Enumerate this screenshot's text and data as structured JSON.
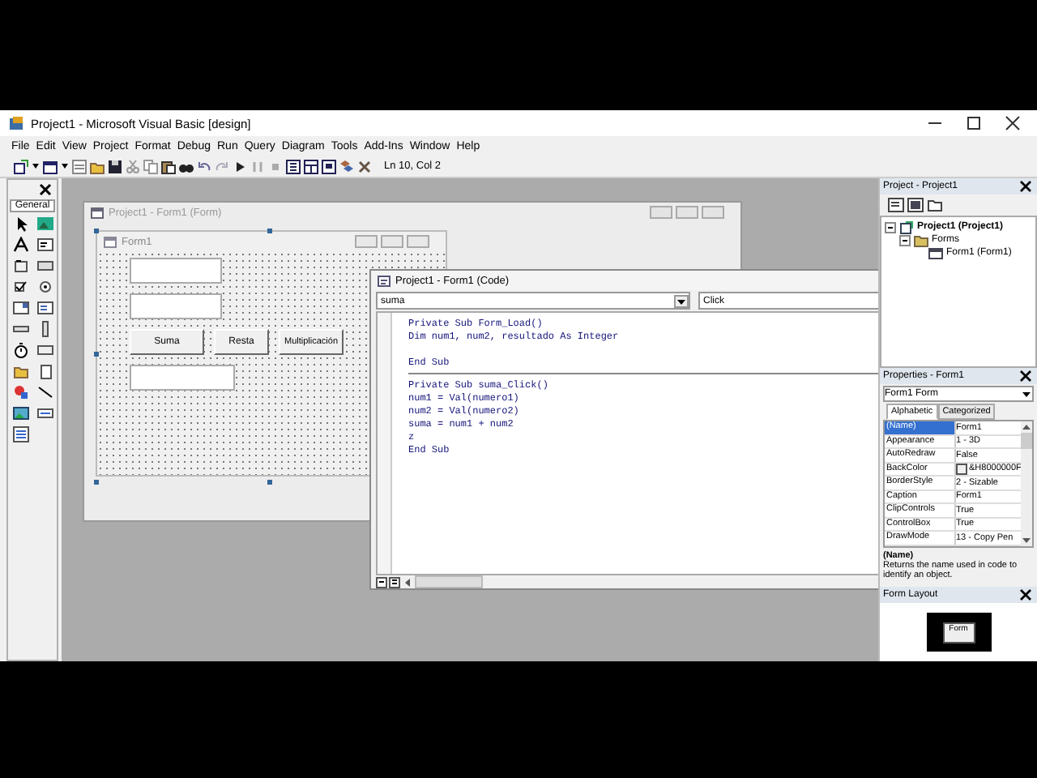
{
  "window": {
    "title": "Project1 - Microsoft Visual Basic [design]"
  },
  "menu": [
    "File",
    "Edit",
    "View",
    "Project",
    "Format",
    "Debug",
    "Run",
    "Query",
    "Diagram",
    "Tools",
    "Add-Ins",
    "Window",
    "Help"
  ],
  "toolbar": {
    "position": "Ln 10, Col 2"
  },
  "toolbox": {
    "tab": "General"
  },
  "form_designer": {
    "title": "Project1 - Form1 (Form)",
    "form": {
      "caption": "Form1",
      "buttons": [
        "Suma",
        "Resta",
        "Multiplicación"
      ]
    }
  },
  "code_window": {
    "title": "Project1 - Form1 (Code)",
    "object": "suma",
    "procedure": "Click",
    "procedures": [
      {
        "lines": [
          "Private Sub Form_Load()",
          "Dim num1, num2, resultado As Integer",
          "End Sub"
        ],
        "blank_line_before_end": true
      },
      {
        "lines": [
          "Private Sub suma_Click()",
          "num1 = Val(numero1)",
          "num2 = Val(numero2)",
          "suma = num1 + num2",
          "z",
          "End Sub"
        ],
        "blank_line_before_end": false
      }
    ]
  },
  "project_explorer": {
    "title": "Project - Project1",
    "tree": [
      {
        "label": "Project1 (Project1)",
        "kind": "project",
        "expanded": true,
        "children": [
          {
            "label": "Forms",
            "kind": "folder",
            "expanded": true,
            "children": [
              {
                "label": "Form1 (Form1)",
                "kind": "form"
              }
            ]
          }
        ]
      }
    ]
  },
  "properties": {
    "title": "Properties - Form1",
    "object": "Form1 Form",
    "tabs": [
      {
        "label": "Alphabetic",
        "selected": true
      },
      {
        "label": "Categorized",
        "selected": false
      }
    ],
    "rows": [
      {
        "name": "(Name)",
        "value": "Form1",
        "selected": true
      },
      {
        "name": "Appearance",
        "value": "1 - 3D",
        "selected": false
      },
      {
        "name": "AutoRedraw",
        "value": "False",
        "selected": false
      },
      {
        "name": "BackColor",
        "value": "&H8000000F",
        "kind": "color",
        "selected": false
      },
      {
        "name": "BorderStyle",
        "value": "2 - Sizable",
        "selected": false
      },
      {
        "name": "Caption",
        "value": "Form1",
        "selected": false
      },
      {
        "name": "ClipControls",
        "value": "True",
        "selected": false
      },
      {
        "name": "ControlBox",
        "value": "True",
        "selected": false
      },
      {
        "name": "DrawMode",
        "value": "13 - Copy Pen",
        "selected": false
      }
    ],
    "description": {
      "heading": "(Name)",
      "text": "Returns the name used in code to identify an object."
    }
  },
  "form_layout": {
    "title": "Form Layout",
    "form_label": "Form"
  }
}
